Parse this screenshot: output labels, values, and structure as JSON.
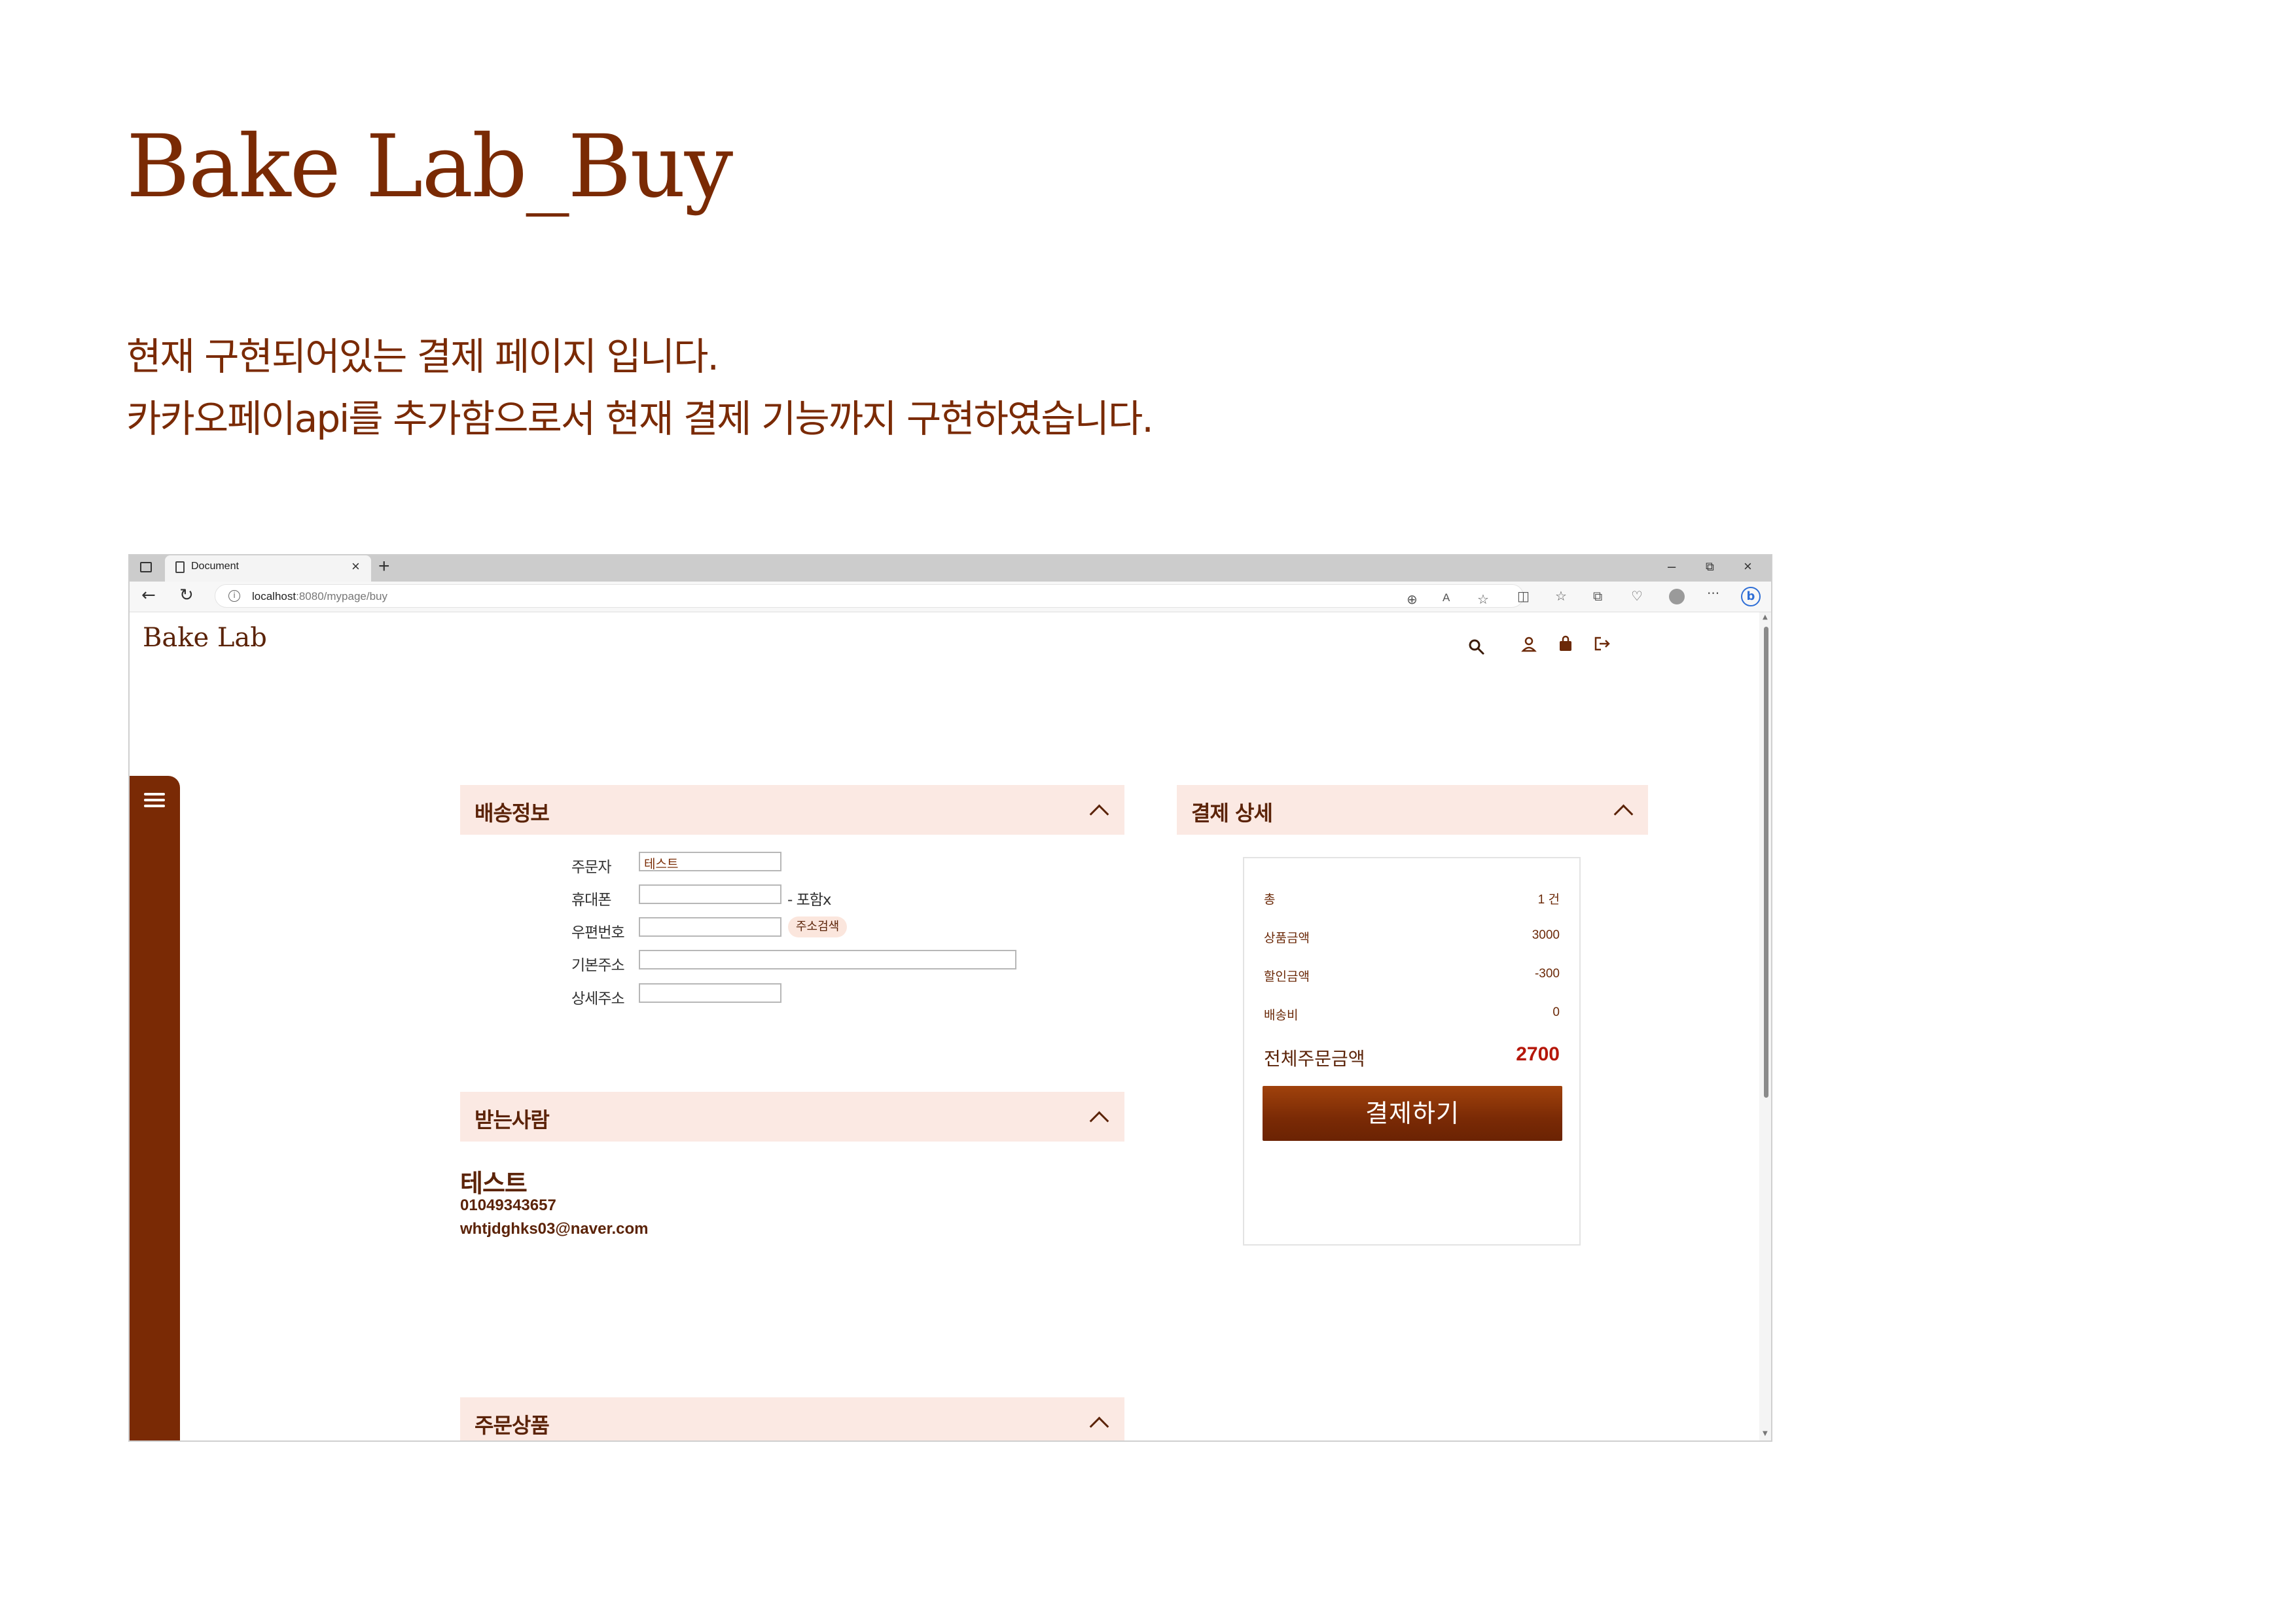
{
  "slide": {
    "title": "Bake Lab_Buy",
    "description_lines": [
      "현재 구현되어있는 결제 페이지 입니다.",
      "카카오페이api를 추가함으로서 현재 결제 기능까지 구현하였습니다."
    ]
  },
  "browser": {
    "tab_title": "Document",
    "tab_close": "×",
    "new_tab": "+",
    "window_controls": {
      "minimize": "–",
      "restore": "⧉",
      "close": "×"
    },
    "url_host": "localhost",
    "url_path": ":8080/mypage/buy",
    "more_menu": "···",
    "scroll_up": "▲",
    "scroll_down": "▼"
  },
  "site": {
    "logo": "Bake Lab"
  },
  "shipping": {
    "title": "배송정보",
    "fields": {
      "orderer_label": "주문자",
      "orderer_value": "테스트",
      "phone_label": "휴대폰",
      "phone_hint": "- 포함x",
      "zipcode_label": "우편번호",
      "address_search": "주소검색",
      "base_address_label": "기본주소",
      "detail_address_label": "상세주소"
    }
  },
  "receiver": {
    "title": "받는사람",
    "name": "테스트",
    "phone": "01049343657",
    "email": "whtjdghks03@naver.com"
  },
  "order_items": {
    "title": "주문상품"
  },
  "payment": {
    "title": "결제 상세",
    "rows": [
      {
        "label": "총",
        "value": "1 건"
      },
      {
        "label": "상품금액",
        "value": "3000"
      },
      {
        "label": "할인금액",
        "value": "-300"
      },
      {
        "label": "배송비",
        "value": "0"
      }
    ],
    "total_label": "전체주문금액",
    "total_value": "2700",
    "pay_button": "결제하기"
  },
  "colors": {
    "brand_brown": "#7a2a05",
    "panel_header_bg": "#fbe9e3",
    "total_red": "#b5170a"
  }
}
